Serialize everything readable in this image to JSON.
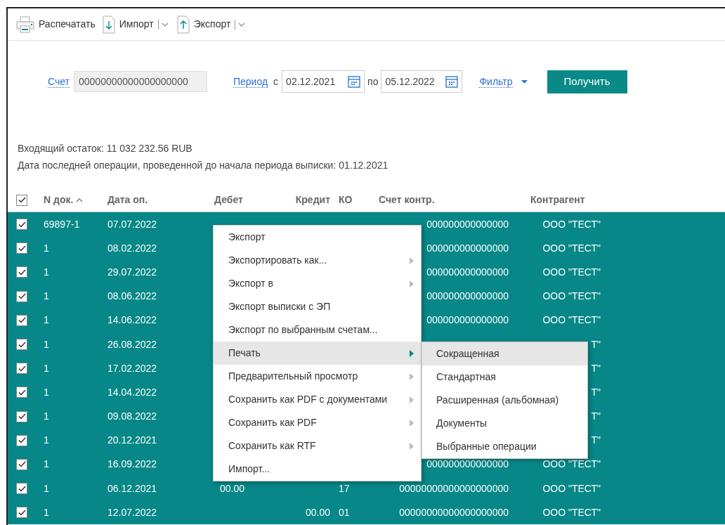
{
  "toolbar": [
    {
      "kind": "print",
      "label": "Распечатать",
      "dropdown": false
    },
    {
      "kind": "import",
      "label": "Импорт",
      "dropdown": true
    },
    {
      "kind": "export",
      "label": "Экспорт",
      "dropdown": true
    }
  ],
  "form": {
    "account_label": "Счет",
    "account_value": "00000000000000000000",
    "period_label": "Период",
    "from_label": "с",
    "from_value": "02.12.2021",
    "to_label": "по",
    "to_value": "05.12.2022",
    "filter_label": "Фильтр",
    "submit": "Получить"
  },
  "info": [
    "Входящий остаток: 11 032 232.56 RUB",
    "Дата последней операции, проведенной до начала периода выписки: 01.12.2021"
  ],
  "table": {
    "all_checked": true,
    "columns": [
      {
        "label": "N док.",
        "sorted": true
      },
      {
        "label": "Дата оп.",
        "sorted": false
      },
      {
        "label": "Дебет",
        "sorted": false
      },
      {
        "label": "Кредит",
        "sorted": false
      },
      {
        "label": "КО",
        "sorted": false
      },
      {
        "label": "Счет контр.",
        "sorted": false
      },
      {
        "label": "Контрагент",
        "sorted": false
      }
    ],
    "rows": [
      {
        "checked": true,
        "doc": "69897-1",
        "date": "07.07.2022",
        "account": "000000000000000",
        "contractor": "ООО \"ТЕСТ\""
      },
      {
        "checked": true,
        "doc": "1",
        "date": "08.02.2022",
        "account": "000000000000000",
        "contractor": "ООО \"ТЕСТ\""
      },
      {
        "checked": true,
        "doc": "1",
        "date": "29.07.2022",
        "account": "000000000000000",
        "contractor": "ООО \"ТЕСТ\""
      },
      {
        "checked": true,
        "doc": "1",
        "date": "08.06.2022",
        "account": "000000000000000",
        "contractor": "ООО \"ТЕСТ\""
      },
      {
        "checked": true,
        "doc": "1",
        "date": "14.06.2022",
        "account": "000000000000000",
        "contractor": "ООО \"ТЕСТ\""
      },
      {
        "checked": true,
        "doc": "1",
        "date": "26.08.2022",
        "contractor": "Т\""
      },
      {
        "checked": true,
        "doc": "1",
        "date": "17.02.2022",
        "contractor": "Т\""
      },
      {
        "checked": true,
        "doc": "1",
        "date": "14.04.2022",
        "contractor": "Т\""
      },
      {
        "checked": true,
        "doc": "1",
        "date": "09.08.2022",
        "contractor": "Т\""
      },
      {
        "checked": true,
        "doc": "1",
        "date": "20.12.2021",
        "contractor": "Т\""
      },
      {
        "checked": true,
        "doc": "1",
        "date": "16.09.2022",
        "account": "000000000000000",
        "contractor": "ООО \"ТЕСТ\""
      },
      {
        "checked": true,
        "doc": "1",
        "date": "06.12.2021",
        "debit": "00.00",
        "ko": "17",
        "account": "00000000000000000000",
        "contractor": "ООО \"ТЕСТ\""
      },
      {
        "checked": true,
        "doc": "1",
        "date": "12.07.2022",
        "credit": "00.00",
        "ko": "01",
        "account": "00000000000000000000",
        "contractor": "ООО \"ТЕСТ\""
      }
    ]
  },
  "context_menu": {
    "items": [
      {
        "label": "Экспорт",
        "submenu": false,
        "selected": false
      },
      {
        "label": "Экспортировать как...",
        "submenu": true,
        "selected": false
      },
      {
        "label": "Экспорт в",
        "submenu": true,
        "selected": false
      },
      {
        "label": "Экспорт выписки с ЭП",
        "submenu": false,
        "selected": false
      },
      {
        "label": "Экспорт по выбранным счетам...",
        "submenu": false,
        "selected": false
      },
      {
        "label": "Печать",
        "submenu": true,
        "selected": true
      },
      {
        "label": "Предварительный просмотр",
        "submenu": true,
        "selected": false
      },
      {
        "label": "Сохранить как PDF с документами",
        "submenu": true,
        "selected": false
      },
      {
        "label": "Сохранить как PDF",
        "submenu": true,
        "selected": false
      },
      {
        "label": "Сохранить как RTF",
        "submenu": true,
        "selected": false
      },
      {
        "label": "Импорт...",
        "submenu": false,
        "selected": false
      }
    ],
    "submenu": [
      {
        "label": "Сокращенная",
        "selected": true
      },
      {
        "label": "Стандартная",
        "selected": false
      },
      {
        "label": "Расширенная (альбомная)",
        "selected": false
      },
      {
        "label": "Документы",
        "selected": false
      },
      {
        "label": "Выбранные операции",
        "selected": false
      }
    ]
  }
}
